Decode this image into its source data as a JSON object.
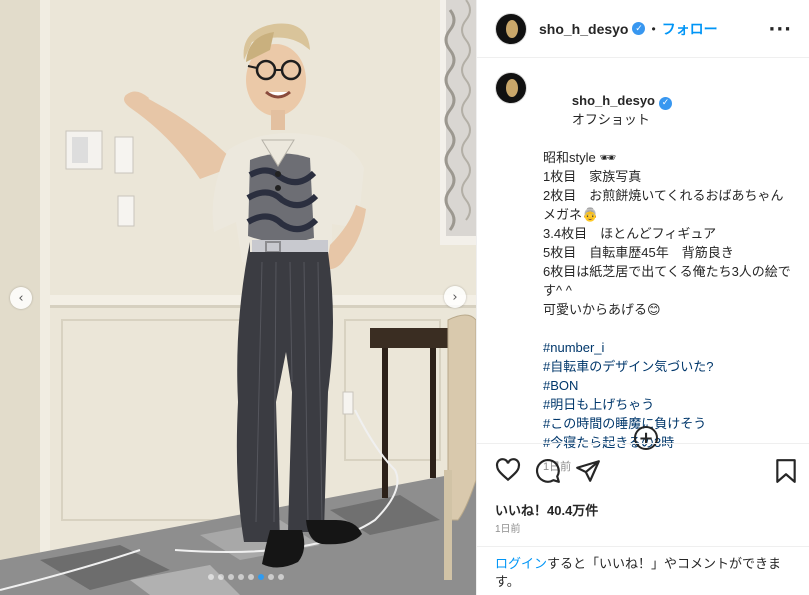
{
  "photo": {
    "prev_icon": "chevron-left-icon",
    "next_icon": "chevron-right-icon",
    "prev_glyph": "‹",
    "next_glyph": "›",
    "dot_count": 8,
    "active_dot": 5
  },
  "header": {
    "username": "sho_h_desyo",
    "separator": "•",
    "follow_label": "フォロー",
    "more_glyph": "···",
    "verified_glyph": "✓"
  },
  "caption": {
    "username": "sho_h_desyo",
    "first_line": "オフショット",
    "lines": [
      "昭和style 🕶",
      "1枚目　家族写真",
      "2枚目　お煎餅焼いてくれるおばあちゃんメガネ👵",
      "3.4枚目　ほとんどフィギュア",
      "5枚目　自転車歴45年　背筋良き",
      "6枚目は紙芝居で出てくる俺たち3人の絵です^ ^",
      "可愛いからあげる😊"
    ],
    "hashtags": [
      "#number_i",
      "#自転車のデザイン気づいた?",
      "#BON",
      "#明日も上げちゃう",
      "#この時間の睡魔に負けそう",
      "#今寝たら起きるの3時"
    ],
    "time_ago": "1日前",
    "plus_glyph": "+"
  },
  "actions": {
    "like_icon": "heart-icon",
    "comment_icon": "comment-icon",
    "share_icon": "share-icon",
    "save_icon": "bookmark-icon"
  },
  "likes": "いいね！40.4万件",
  "date": "1日前",
  "login_prompt": {
    "link": "ログイン",
    "text": "すると「いいね！」やコメントができます。"
  },
  "colors": {
    "accent": "#0095f6",
    "hashtag": "#00376b",
    "verified": "#3897f0",
    "active_dot": "#2f9bf0"
  }
}
